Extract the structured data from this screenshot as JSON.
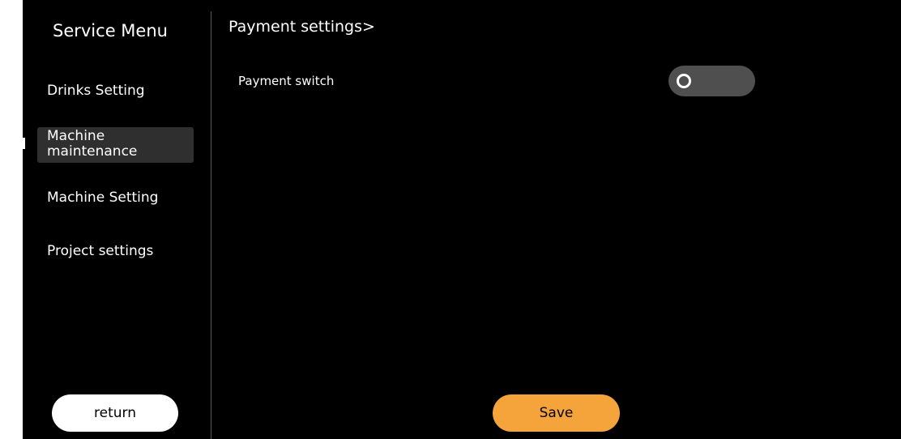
{
  "sidebar": {
    "title": "Service Menu",
    "items": [
      {
        "label": "Drinks Setting"
      },
      {
        "label": "Machine maintenance"
      },
      {
        "label": "Machine Setting"
      },
      {
        "label": "Project settings"
      }
    ],
    "active_index": 1,
    "return_label": "return"
  },
  "main": {
    "title": "Payment settings>",
    "settings": [
      {
        "label": "Payment switch",
        "control": "toggle",
        "value": "off"
      }
    ],
    "save_label": "Save"
  },
  "colors": {
    "background": "#000000",
    "active_item_bg": "#2f2f2f",
    "toggle_off": "#4f4f4f",
    "save_button": "#f5a33b",
    "return_button": "#ffffff"
  },
  "icons": {
    "toggle_knob": "toggle-knob-icon"
  }
}
